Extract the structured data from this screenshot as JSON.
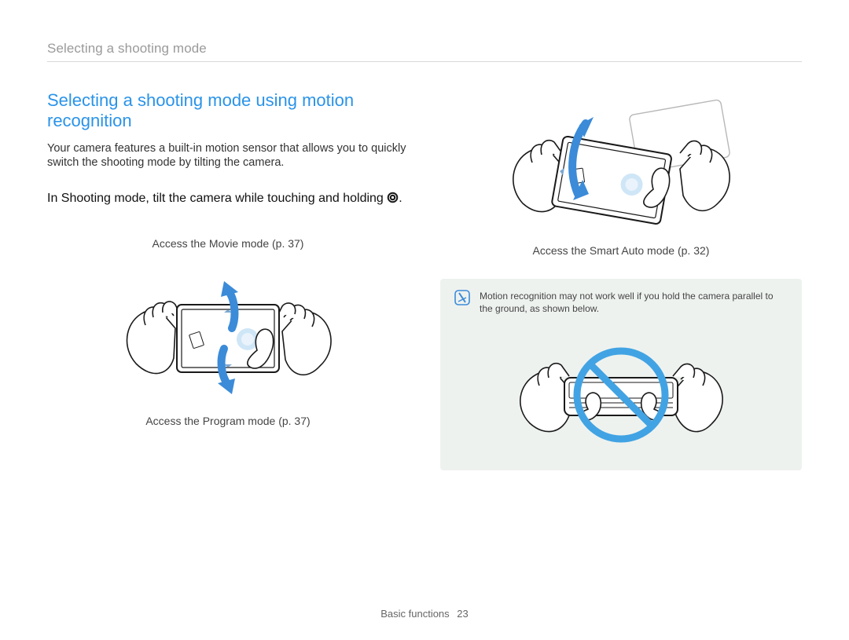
{
  "running_head": "Selecting a shooting mode",
  "h2": "Selecting a shooting mode using motion recognition",
  "intro": "Your camera features a built-in motion sensor that allows you to quickly switch the shooting mode by tilting the camera.",
  "body_pre": "In Shooting mode, tilt the camera while touching and holding",
  "body_post": ".",
  "left": {
    "caption_top": "Access the Movie mode (p. 37)",
    "caption_bottom": "Access the Program mode (p. 37)"
  },
  "right": {
    "caption_top": "Access the Smart Auto mode (p. 32)"
  },
  "note": "Motion recognition may not work well if you hold the camera parallel to the ground, as shown below.",
  "footer_section": "Basic functions",
  "footer_page": "23",
  "colors": {
    "accent": "#2a93e8",
    "blue": "#3b8bd8",
    "note_bg": "#eef2ef"
  }
}
